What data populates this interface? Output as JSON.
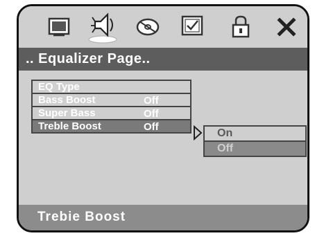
{
  "iconbar": {
    "icons": [
      "monitor-icon",
      "speaker-icon",
      "disc-icon",
      "checklist-icon",
      "lock-icon",
      "close-icon"
    ]
  },
  "title": ".. Equalizer Page..",
  "menu": {
    "items": [
      {
        "label": "EQ Type",
        "value": ""
      },
      {
        "label": "Bass Boost",
        "value": "Off"
      },
      {
        "label": "Super Bass",
        "value": "Off"
      },
      {
        "label": "Treble  Boost",
        "value": "Off"
      }
    ],
    "selected_index": 3
  },
  "submenu": {
    "options": [
      "On",
      "Off"
    ],
    "highlighted": "Off"
  },
  "status": "Trebie  Boost",
  "colors": {
    "background": "#cfcfcf",
    "title_bar": "#5d5d5d",
    "selected_row": "#7a7a7a",
    "status_bar": "#8c8c8c",
    "text": "#ffffff"
  }
}
